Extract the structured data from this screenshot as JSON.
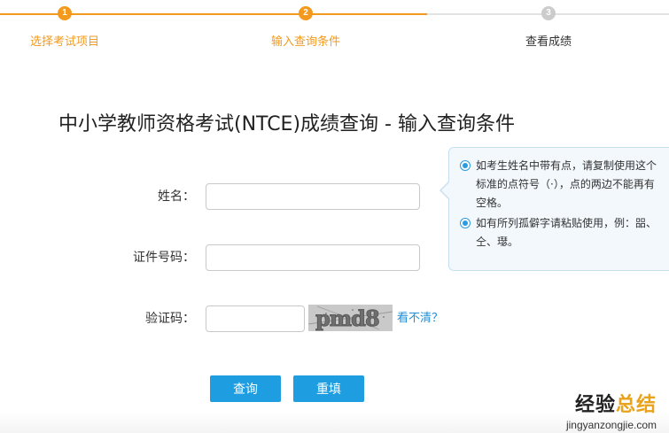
{
  "steps": [
    {
      "num": "1",
      "label": "选择考试项目",
      "state": "done"
    },
    {
      "num": "2",
      "label": "输入查询条件",
      "state": "active"
    },
    {
      "num": "3",
      "label": "查看成绩",
      "state": "pending"
    }
  ],
  "colors": {
    "accent_orange": "#f39a1e",
    "accent_blue": "#1e9ee0",
    "link_blue": "#1e8fd8",
    "tip_bg": "#f2f8fc"
  },
  "title": "中小学教师资格考试(NTCE)成绩查询 - 输入查询条件",
  "form": {
    "name_label": "姓名：",
    "name_value": "",
    "id_label": "证件号码：",
    "id_value": "",
    "captcha_label": "验证码：",
    "captcha_value": "",
    "captcha_text": "pmd8",
    "refresh_link": "看不清？"
  },
  "tips": [
    "如考生姓名中带有点，请复制使用这个标准的点符号（·），点的两边不能再有空格。",
    "如有所列孤僻字请粘贴使用，例：㗊、仝、璱。"
  ],
  "buttons": {
    "query": "查询",
    "reset": "重填"
  },
  "watermark": {
    "cn_main": "经验",
    "cn_highlight": "总结",
    "url": "jingyanzongjie.com"
  }
}
